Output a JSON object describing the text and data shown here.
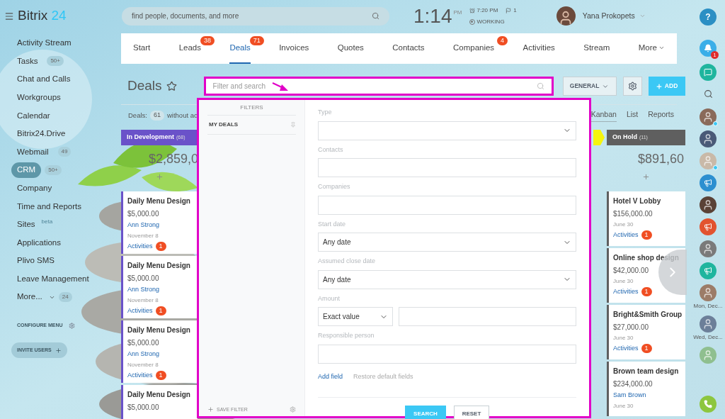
{
  "logo": {
    "name": "Bitrix",
    "number": "24"
  },
  "search": {
    "placeholder": "find people, documents, and more"
  },
  "clock": {
    "time": "1:14",
    "ampm": "PM",
    "alarm": "7:20 PM",
    "flags": "1",
    "status": "WORKING"
  },
  "user": {
    "name": "Yana Prokopets"
  },
  "sidebar": {
    "items": [
      {
        "label": "Activity Stream",
        "selected": false
      },
      {
        "label": "Tasks",
        "badge": "50+",
        "selected": false
      },
      {
        "label": "Chat and Calls",
        "selected": false
      },
      {
        "label": "Workgroups",
        "selected": false
      },
      {
        "label": "Calendar",
        "selected": false
      },
      {
        "label": "Bitrix24.Drive",
        "selected": false
      },
      {
        "label": "Webmail",
        "badge": "49",
        "selected": false
      },
      {
        "label": "CRM",
        "badge": "50+",
        "selected": true
      },
      {
        "label": "Company",
        "selected": false
      },
      {
        "label": "Time and Reports",
        "selected": false
      },
      {
        "label": "Sites",
        "tag": "beta",
        "selected": false
      },
      {
        "label": "Applications",
        "selected": false
      },
      {
        "label": "Plivo SMS",
        "selected": false
      },
      {
        "label": "Leave Management",
        "selected": false
      },
      {
        "label": "More...",
        "badge": "24",
        "selected": false,
        "dropdown": true
      }
    ],
    "configure": "CONFIGURE MENU",
    "invite": "INVITE USERS"
  },
  "tabs": [
    {
      "label": "Start",
      "selected": false
    },
    {
      "label": "Leads",
      "badge": "38",
      "selected": false
    },
    {
      "label": "Deals",
      "badge": "71",
      "selected": true
    },
    {
      "label": "Invoices",
      "selected": false
    },
    {
      "label": "Quotes",
      "selected": false
    },
    {
      "label": "Contacts",
      "selected": false
    },
    {
      "label": "Companies",
      "badge": "4",
      "selected": false
    },
    {
      "label": "Activities",
      "selected": false
    },
    {
      "label": "Stream",
      "selected": false
    },
    {
      "label": "More",
      "selected": false,
      "dropdown": true
    }
  ],
  "page": {
    "title": "Deals",
    "filter_placeholder": "Filter and search",
    "view_button": "GENERAL",
    "add_button": "ADD"
  },
  "summary": {
    "label": "Deals:",
    "count": "61",
    "text": "without ac"
  },
  "views": [
    {
      "label": "Kanban",
      "selected": true
    },
    {
      "label": "List",
      "selected": false
    },
    {
      "label": "Reports",
      "selected": false
    }
  ],
  "columns": [
    {
      "title": "In Development",
      "count": "(68)",
      "color": "#6a52c9",
      "total": "$2,859,0",
      "cards": [
        {
          "title": "Daily Menu Design",
          "amount": "$5,000.00",
          "contact": "Ann Strong",
          "date": "November 8",
          "activities": "Activities",
          "activity_count": "1"
        },
        {
          "title": "Daily Menu Design",
          "amount": "$5,000.00",
          "contact": "Ann Strong",
          "date": "November 8",
          "activities": "Activities",
          "activity_count": "1"
        },
        {
          "title": "Daily Menu Design",
          "amount": "$5,000.00",
          "contact": "Ann Strong",
          "date": "November 8",
          "activities": "Activities",
          "activity_count": "1"
        },
        {
          "title": "Daily Menu Design",
          "amount": "$5,000.00"
        }
      ]
    },
    {
      "title": "On Hold",
      "count": "(11)",
      "color": "#5f5f5f",
      "total": "$891,60",
      "cards": [
        {
          "title": "Hotel V Lobby",
          "amount": "$156,000.00",
          "date": "June 30",
          "activities": "Activities",
          "activity_count": "1"
        },
        {
          "title": "Online shop design",
          "amount": "$42,000.00",
          "date": "June 30",
          "activities": "Activities",
          "activity_count": "1"
        },
        {
          "title": "Bright&Smith Group",
          "amount": "$27,000.00",
          "date": "June 30",
          "activities": "Activities",
          "activity_count": "1"
        },
        {
          "title": "Brown team design",
          "amount": "$234,000.00",
          "contact": "Sam Brown",
          "date": "June 30"
        }
      ]
    }
  ],
  "filter_popup": {
    "header": "FILTERS",
    "presets": [
      {
        "label": "MY DEALS"
      }
    ],
    "save": "SAVE FILTER",
    "fields": [
      {
        "label": "Type",
        "kind": "select"
      },
      {
        "label": "Contacts",
        "kind": "text"
      },
      {
        "label": "Companies",
        "kind": "text"
      },
      {
        "label": "Start date",
        "kind": "select",
        "value": "Any date"
      },
      {
        "label": "Assumed close date",
        "kind": "select",
        "value": "Any date"
      },
      {
        "label": "Amount",
        "kind": "range",
        "value": "Exact value"
      },
      {
        "label": "Responsible person",
        "kind": "text"
      }
    ],
    "add_field": "Add field",
    "restore": "Restore default fields",
    "search_button": "SEARCH",
    "reset_button": "RESET"
  },
  "right_rail": {
    "help": "?",
    "notifications": "1",
    "contacts": [
      {
        "kind": "avatar",
        "color": "#8a6a5a",
        "online": true
      },
      {
        "kind": "avatar",
        "color": "#4a5a78",
        "online": false
      },
      {
        "kind": "avatar",
        "color": "#c9b9a8",
        "online": true
      },
      {
        "kind": "group",
        "color": "#2d8fd0",
        "online": false
      },
      {
        "kind": "avatar",
        "color": "#5a4236",
        "online": false
      },
      {
        "kind": "group",
        "color": "#e2532f",
        "online": false
      },
      {
        "kind": "avatar",
        "color": "#7a7a7a",
        "online": false
      },
      {
        "kind": "group",
        "color": "#1fb59e",
        "online": false
      },
      {
        "kind": "avatar",
        "color": "#9c7c68",
        "online": false,
        "caption": "Mon, Dec..."
      },
      {
        "kind": "avatar",
        "color": "#6c7f99",
        "online": false,
        "caption": "Wed, Dec..."
      },
      {
        "kind": "avatar",
        "color": "#8fbf8f",
        "online": false
      }
    ]
  }
}
